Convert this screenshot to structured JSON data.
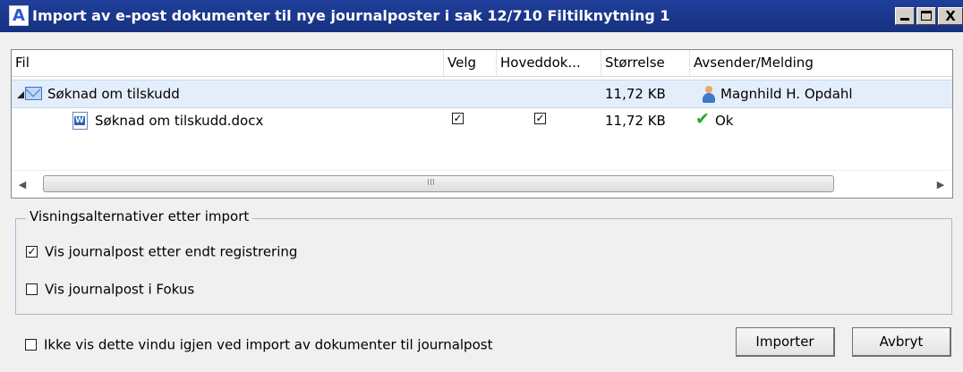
{
  "window": {
    "title": "Import av e-post dokumenter til nye journalposter i sak 12/710 Filtilknytning 1",
    "app_icon_letter": "A",
    "close_glyph": "X"
  },
  "grid": {
    "columns": [
      "Fil",
      "Velg",
      "Hoveddok...",
      "Størrelse",
      "Avsender/Melding"
    ],
    "rows": [
      {
        "name": "Søknad om tilskudd",
        "size": "11,72 KB",
        "sender": "Magnhild H. Opdahl",
        "icon": "envelope-icon",
        "expanded": true
      },
      {
        "name": "Søknad om tilskudd.docx",
        "velg": true,
        "hoveddok": true,
        "size": "11,72 KB",
        "message": "Ok",
        "icon": "word-document-icon"
      }
    ],
    "scroll_grip": "III"
  },
  "options": {
    "group_label": "Visningsalternativer etter import",
    "items": [
      {
        "label": "Vis journalpost etter endt registrering",
        "checked": true
      },
      {
        "label": "Vis journalpost i Fokus",
        "checked": false
      }
    ]
  },
  "footer": {
    "dont_show_label": "Ikke vis dette vindu igjen ved import av dokumenter til journalpost",
    "dont_show_checked": false,
    "import_label": "Importer",
    "cancel_label": "Avbryt"
  },
  "colors": {
    "titlebar": "#1f3f9a",
    "selection": "#e4eefb",
    "ok": "#2ea52e"
  }
}
